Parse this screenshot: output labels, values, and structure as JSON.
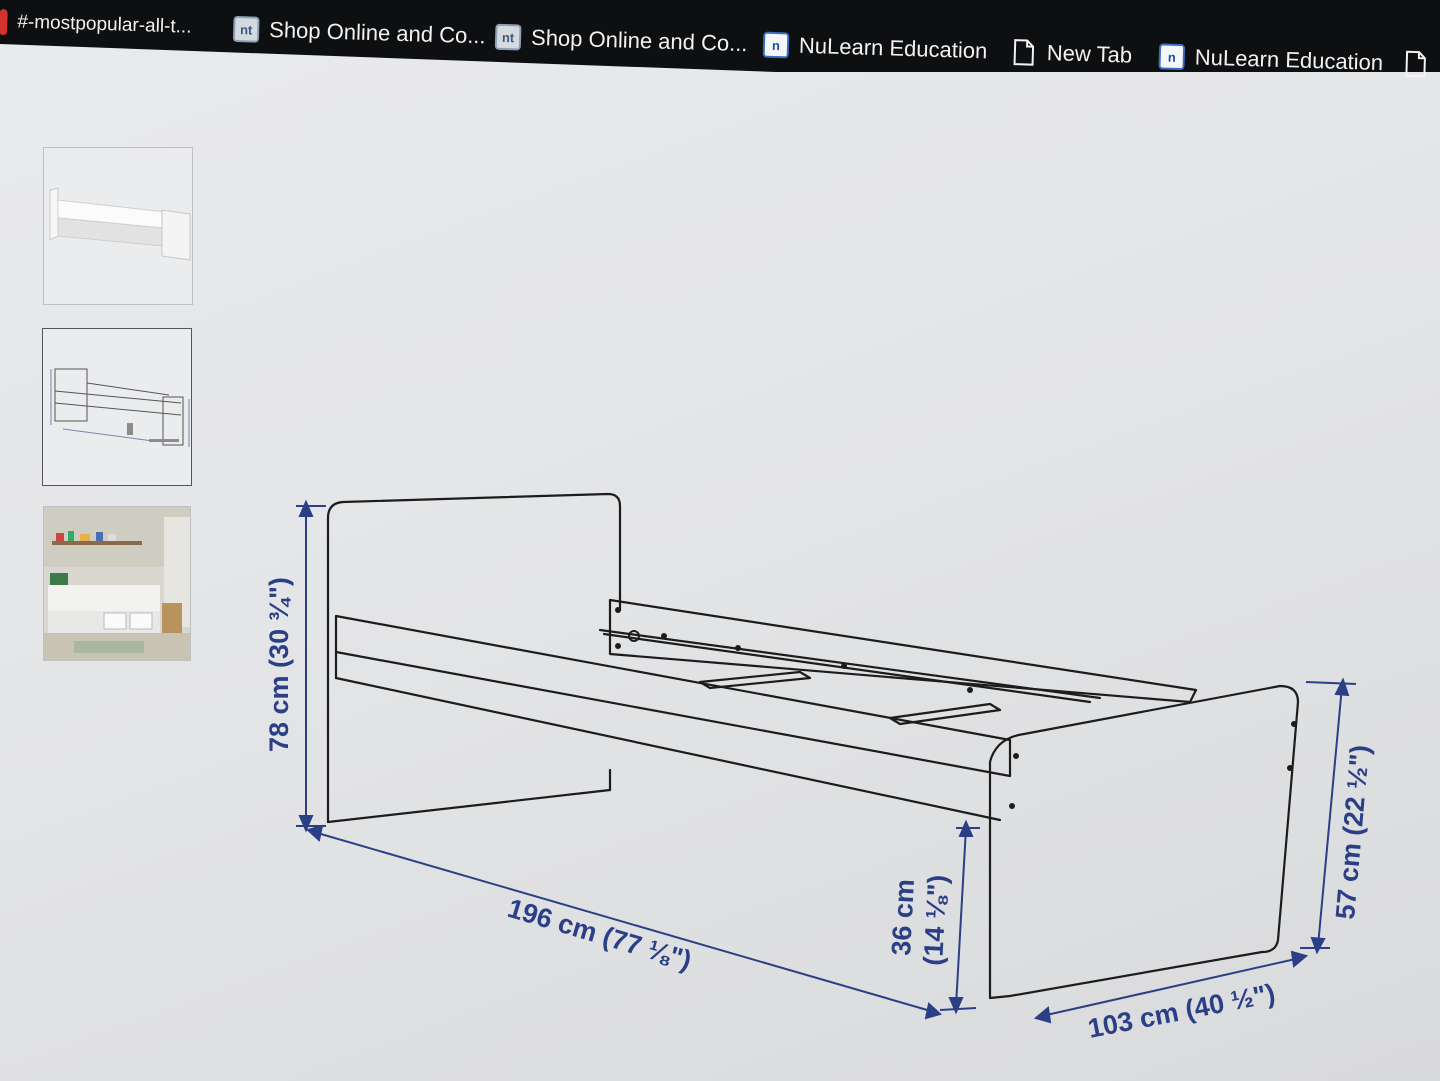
{
  "bookmarks": [
    {
      "label": "#-mostpopular-all-t...",
      "icon": "red-mark-icon"
    },
    {
      "label": "Shop Online and Co...",
      "icon": "nt-logo-icon"
    },
    {
      "label": "Shop Online and Co...",
      "icon": "nt-logo-icon"
    },
    {
      "label": "NuLearn Education",
      "icon": "nulearn-logo-icon"
    },
    {
      "label": "New Tab",
      "icon": "page-icon"
    },
    {
      "label": "NuLearn Education",
      "icon": "nulearn-logo-icon"
    }
  ],
  "dimensions": {
    "headboard_height": "78 cm (30 ¾\")",
    "length": "196 cm (77 ⅛\")",
    "under_bed_height": "36 cm",
    "under_bed_height_in": "(14 ⅛\")",
    "footboard_height": "57 cm (22 ½\")",
    "width": "103 cm (40 ½\")"
  },
  "colors": {
    "dimension_blue": "#2b3f86",
    "line_art": "#1c1c1c"
  }
}
